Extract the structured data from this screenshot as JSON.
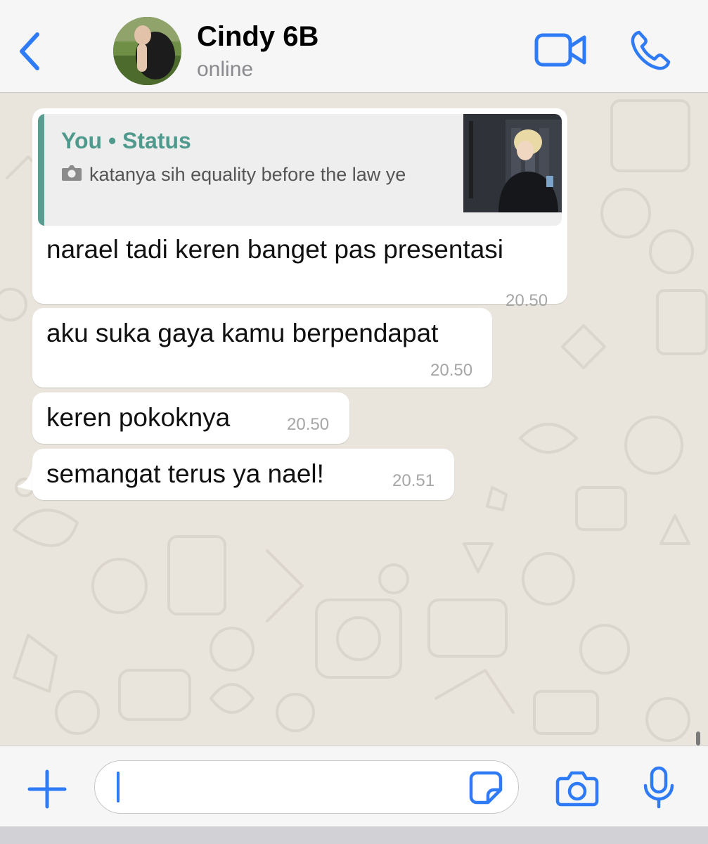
{
  "colors": {
    "accent": "#2f7bf6",
    "quote_accent": "#5a9c8f",
    "bubble": "#ffffff",
    "chat_background": "#e9e5dd"
  },
  "header": {
    "back_icon": "chevron-left-icon",
    "contact_name": "Cindy 6B",
    "contact_status": "online",
    "video_icon": "video-call-icon",
    "call_icon": "phone-icon"
  },
  "messages": [
    {
      "reply_to": {
        "author": "You • Status",
        "icon": "camera-icon",
        "text": "katanya sih equality before the law ye"
      },
      "text": "narael tadi keren banget pas presentasi",
      "time": "20.50"
    },
    {
      "text": "aku suka gaya kamu berpendapat",
      "time": "20.50"
    },
    {
      "text": "keren pokoknya",
      "time": "20.50"
    },
    {
      "text": "semangat terus ya nael!",
      "time": "20.51"
    }
  ],
  "composer": {
    "input_value": "",
    "plus_icon": "plus-icon",
    "sticker_icon": "sticker-icon",
    "camera_icon": "camera-icon",
    "mic_icon": "microphone-icon"
  }
}
